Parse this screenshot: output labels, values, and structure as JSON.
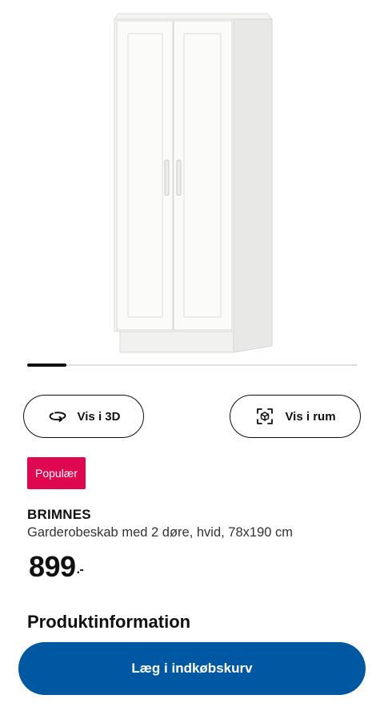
{
  "gallery": {
    "image_alt": "BRIMNES wardrobe, white",
    "progress_fraction": 0.12
  },
  "actions": {
    "view_3d_label": "Vis i 3D",
    "view_room_label": "Vis i rum",
    "view_3d_icon": "rotate-3d-icon",
    "view_room_icon": "ar-view-icon"
  },
  "badge": {
    "label": "Populær",
    "color": "#e00751"
  },
  "product": {
    "name": "BRIMNES",
    "description": "Garderobeskab med 2 døre, hvid, 78x190 cm",
    "price": "899",
    "price_suffix": ".-"
  },
  "section": {
    "title": "Produktinformation"
  },
  "cart": {
    "label": "Læg i indkøbskurv",
    "color": "#0058a3"
  }
}
